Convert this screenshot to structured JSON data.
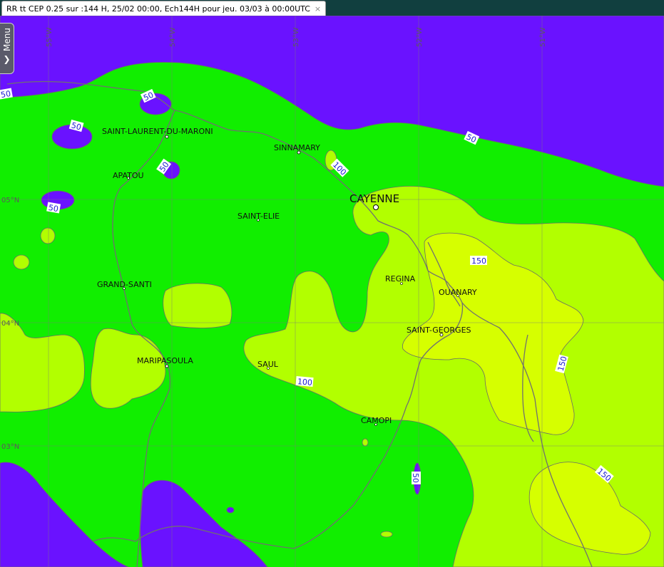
{
  "tab": {
    "title": "RR tt CEP 0.25 sur :144 H, 25/02 00:00, Ech144H pour jeu. 03/03 à 00:00UTC",
    "close_glyph": "×"
  },
  "menu": {
    "label": "Menu",
    "chevron": "❯"
  },
  "colors": {
    "lt50": "#6a12ff",
    "c50_100": "#11ee00",
    "c100_150": "#b2ff00",
    "gt150": "#d6ff00"
  },
  "graticule": {
    "lat_labels": [
      "05°N",
      "04°N",
      "03°N"
    ],
    "lon_labels": [
      "55°W",
      "54°W",
      "53°W",
      "52°W",
      "51°W"
    ]
  },
  "cities": {
    "saint_laurent": "SAINT-LAURENT-DU-MARONI",
    "sinnamary": "SINNAMARY",
    "apatou": "APATOU",
    "cayenne": "CAYENNE",
    "saint_elie": "SAINT-ELIE",
    "regina": "REGINA",
    "ouanary": "OUANARY",
    "grand_santi": "GRAND-SANTI",
    "saint_georges": "SAINT-GEORGES",
    "maripasoula": "MARIPASOULA",
    "saul": "SAUL",
    "camopi": "CAMOPI"
  },
  "contour_labels": {
    "c50": "50",
    "c100": "100",
    "c150": "150"
  }
}
